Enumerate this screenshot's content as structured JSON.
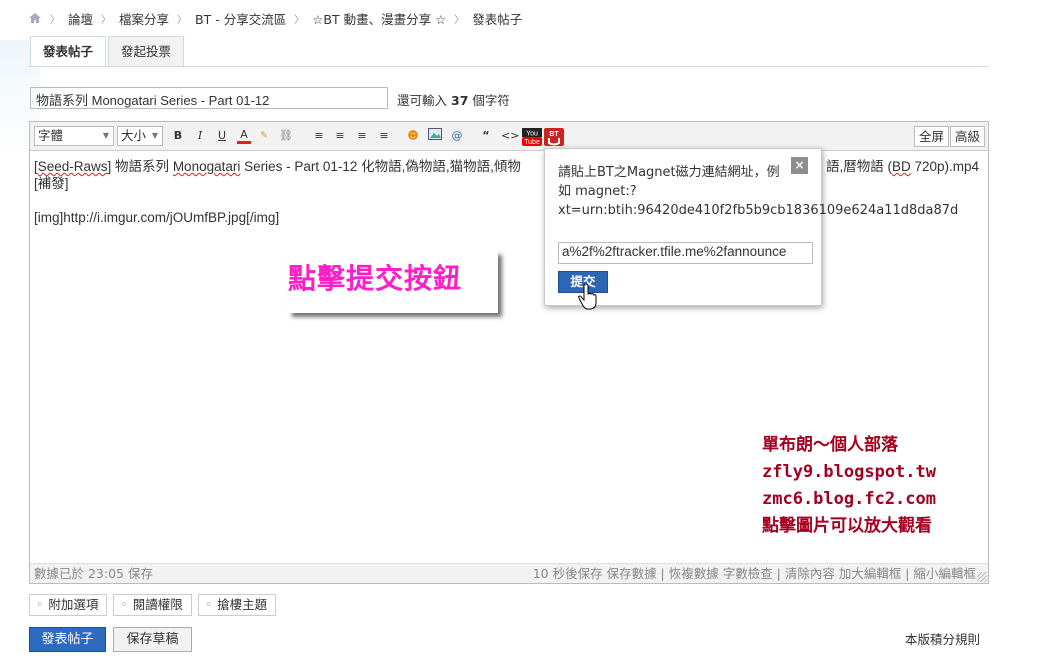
{
  "breadcrumb": {
    "items": [
      "論壇",
      "檔案分享",
      "BT - 分享交流區",
      "☆BT 動畫、漫畫分享 ☆",
      "發表帖子"
    ]
  },
  "tabs": [
    "發表帖子",
    "發起投票"
  ],
  "subject": {
    "value": "物語系列 Monogatari Series - Part 01-12",
    "remain_prefix": "還可輸入",
    "remain_count": "37",
    "remain_suffix": "個字符"
  },
  "toolbar": {
    "font_label": "字體",
    "size_label": "大小",
    "full_label": "全屏",
    "advanced_label": "高級"
  },
  "content": {
    "line1_tag": "Seed-Raws",
    "line1_a": "] 物語系列 ",
    "line1_b": "Monogatari",
    "line1_c": " Series - Part 01-12 化物語,偽物語,猫物語,傾物",
    "line1_tail_a": "語,暦物語 (",
    "line1_tail_b": "BD",
    "line1_tail_c": " 720p).mp4",
    "line2": "[補發]",
    "line3": "[img]http://i.imgur.com/jOUmfBP.jpg[/img]"
  },
  "status": {
    "saved": "數據已於 23:05 保存",
    "actions": "10 秒後保存 保存數據 | 恢複數據    字數檢查 | 清除內容    加大編輯框 | 縮小編輯框"
  },
  "popup": {
    "message": "請貼上BT之Magnet磁力連結網址，例如 magnet:?xt=urn:btih:96420de410f2fb5b9cb1836109e624a11d8da87d",
    "input_value": "a%2f%2ftracker.tfile.me%2fannounce",
    "submit_label": "提交",
    "close_label": "×"
  },
  "annotation": {
    "text": "點擊提交按鈕"
  },
  "blog": {
    "line1": "單布朗～個人部落",
    "line2": "zfly9.blogspot.tw",
    "line3": "zmc6.blog.fc2.com",
    "line4": "點擊圖片可以放大觀看"
  },
  "options": [
    "附加選項",
    "閱讀權限",
    "搶樓主題"
  ],
  "buttons": {
    "submit": "發表帖子",
    "draft": "保存草稿"
  },
  "rules_link": "本版積分規則",
  "colors": {
    "accent": "#2d6ac0",
    "annotation": "#ff1fc8",
    "blog": "#a30020"
  }
}
